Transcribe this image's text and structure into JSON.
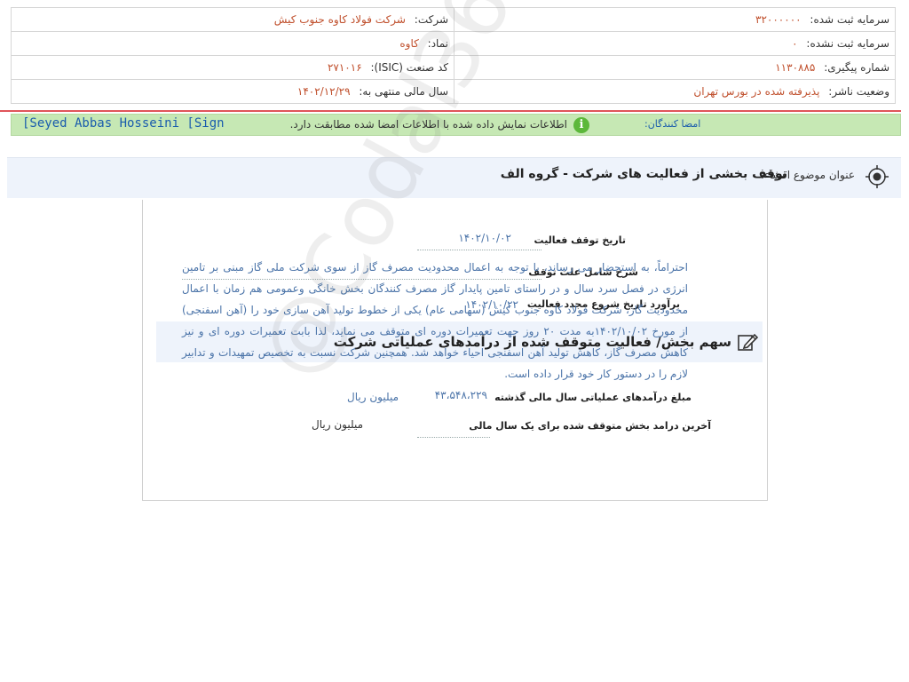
{
  "info": {
    "company_label": "شرکت:",
    "company_value": "شرکت فولاد کاوه جنوب کیش",
    "symbol_label": "نماد:",
    "symbol_value": "کاوه",
    "isic_label": "کد صنعت (ISIC):",
    "isic_value": "۲۷۱۰۱۶",
    "fiscal_label": "سال مالی منتهی به:",
    "fiscal_value": "۱۴۰۲/۱۲/۲۹",
    "registered_capital_label": "سرمایه ثبت شده:",
    "registered_capital_value": "۳۲۰۰۰۰۰۰",
    "unregistered_capital_label": "سرمایه ثبت نشده:",
    "unregistered_capital_value": "۰",
    "tracking_label": "شماره پیگیری:",
    "tracking_value": "۱۱۳۰۸۸۵",
    "publisher_status_label": "وضعیت ناشر:",
    "publisher_status_value": "پذیرفته شده در بورس تهران"
  },
  "notice": {
    "message": "اطلاعات نمایش داده شده با اطلاعات امضا شده مطابقت دارد.",
    "signers_label": "امضا کنندگان:",
    "signers_value": "[Seyed Abbas Hosseini [Sign"
  },
  "subject": {
    "label": "عنوان موضوع افشاء:",
    "title": "توقف بخشی از فعالیت های شرکت - گروه الف"
  },
  "report": {
    "stop_date_label": "تاریخ توقف فعالیت",
    "stop_date_value": "۱۴۰۲/۱۰/۰۲",
    "reason_label": "شرح شامل علت توقف",
    "reason_text": "احتراماً، به استحضار می رساند، با توجه به اعمال محدودیت مصرف گاز از سوی شرکت ملی گاز مبنی بر تامین انرژی در فصل سرد سال و در راستای تامین پایدار گاز مصرف کنندگان بخش خانگی وعمومی هم زمان با اعمال محدودیت گاز، شرکت فولاد کاوه جنوب کیش (سهامی عام) یکی از خطوط تولید آهن سازی خود را (آهن اسفنجی) از مورخ ۱۴۰۲/۱۰/۰۲به مدت ۲۰ روز جهت تعمیرات دوره ای متوقف می نماید، لذا بابت تعمیرات دوره ای و نیز کاهش مصرف گاز، کاهش تولید آهن اسفنجی احیاء خواهد شد. همچنین شرکت نسبت به تخصیص تمهیدات و تدابیر لازم را در دستور کار خود قرار داده است.",
    "restart_label": "برآورد تاریخ شروع مجدد فعالیت",
    "restart_value": "۱۴۰۲/۱۰/۲۲",
    "section_title": "سهم بخش/ فعالیت متوقف شده از درآمدهای عملیاتی شرکت",
    "prior_revenue_label": "مبلغ درآمدهای عملیاتی سال مالی گذشته",
    "prior_revenue_value": "۴۳،۵۴۸،۲۲۹",
    "prior_revenue_unit": "میلیون ریال",
    "last_revenue_label": "آخرین درامد بخش متوقف شده برای یک سال مالی",
    "last_revenue_unit": "میلیون ریال"
  },
  "watermark": "@Codal360_ir"
}
